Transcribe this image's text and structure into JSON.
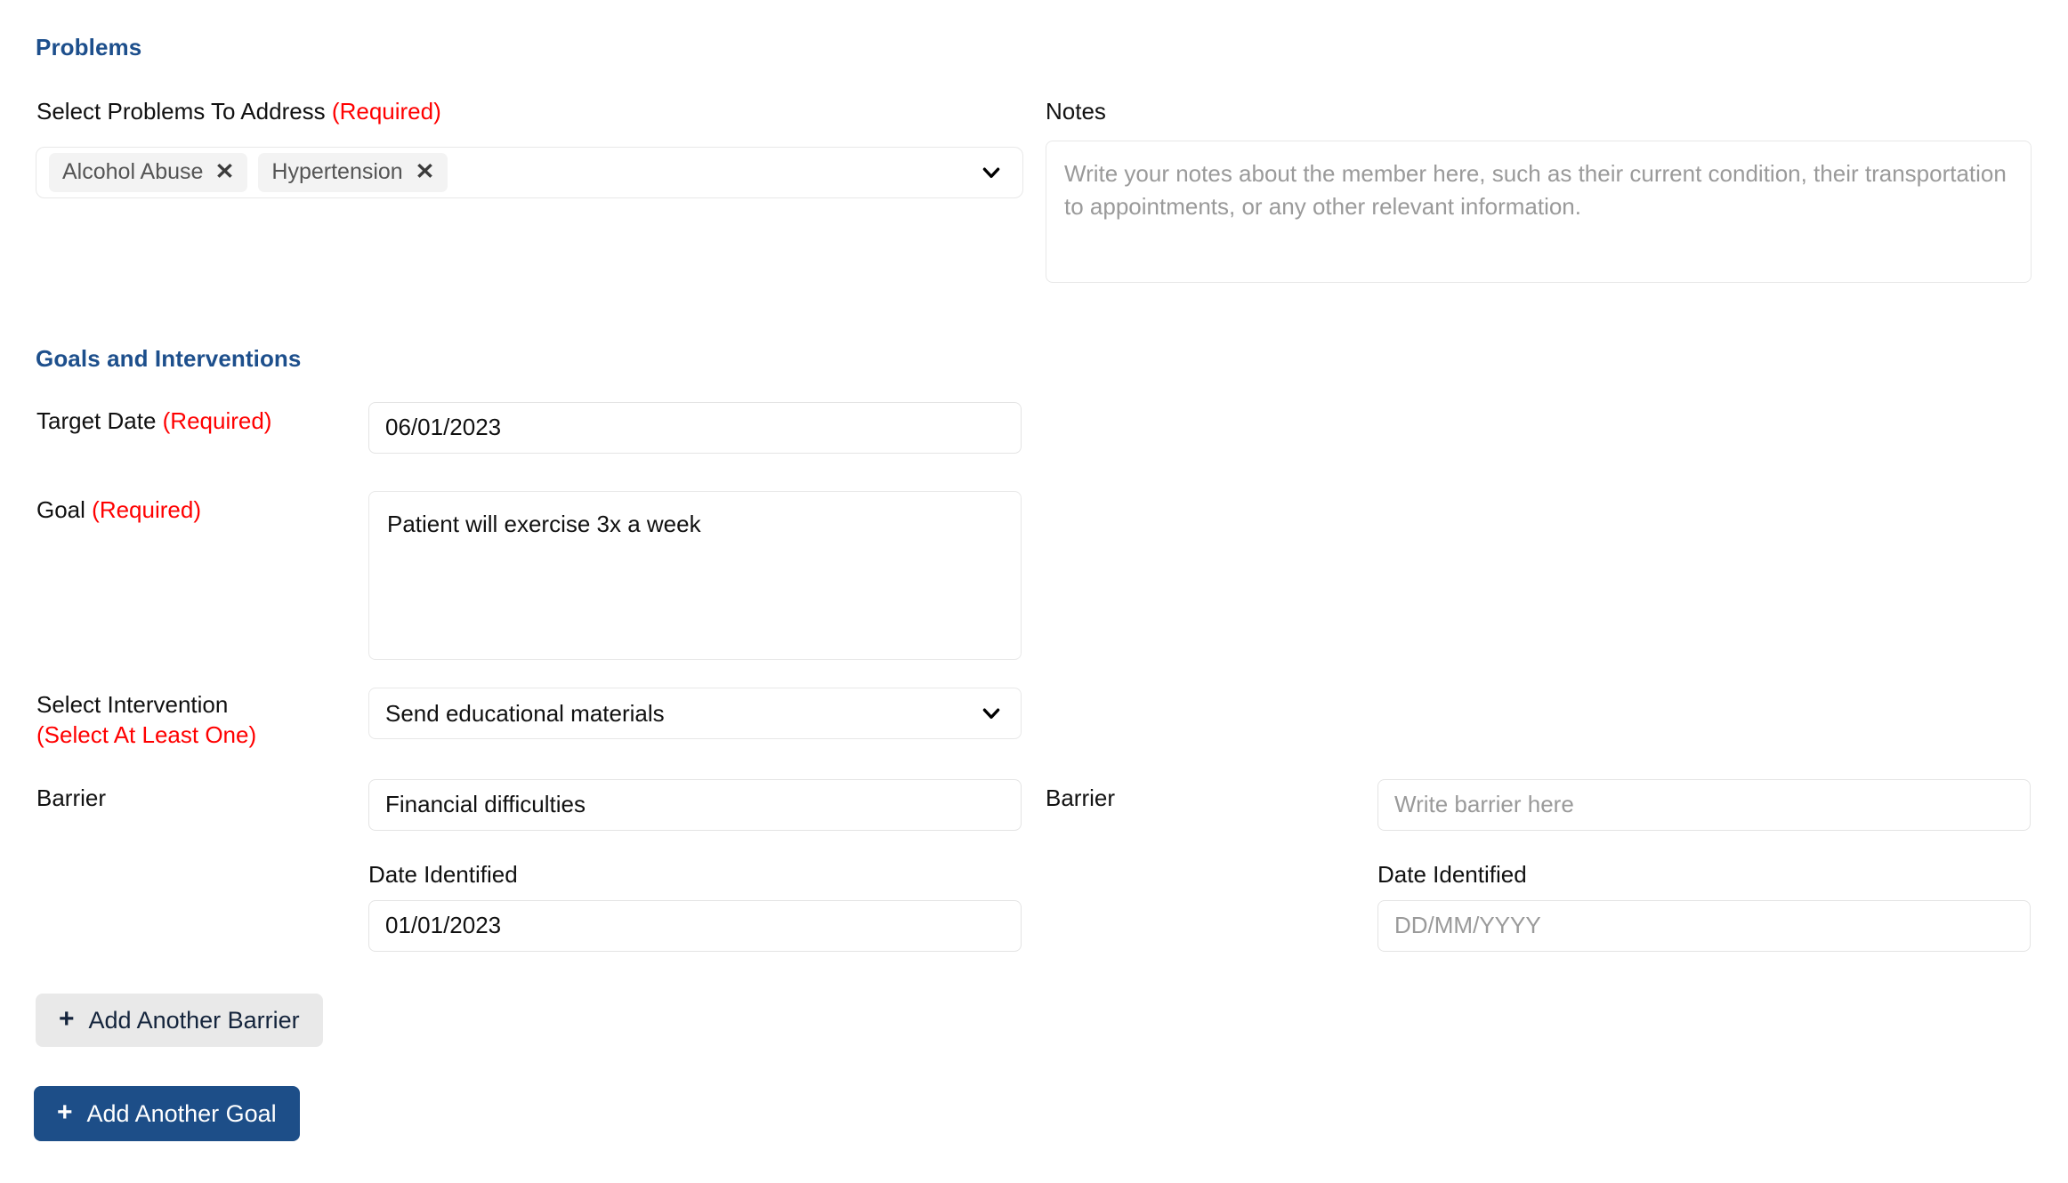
{
  "problems": {
    "heading": "Problems",
    "select_label": "Select Problems To Address",
    "select_required": "(Required)",
    "chips": [
      {
        "label": "Alcohol Abuse",
        "remove_icon": "✕"
      },
      {
        "label": "Hypertension",
        "remove_icon": "✕"
      }
    ]
  },
  "notes": {
    "label": "Notes",
    "value": "",
    "placeholder": "Write your notes about the member here, such as their current condition, their transportation to appointments, or any other relevant information."
  },
  "goals": {
    "heading": "Goals and Interventions",
    "target_date": {
      "label": "Target Date",
      "required": "(Required)",
      "value": "06/01/2023"
    },
    "goal": {
      "label": "Goal",
      "required": "(Required)",
      "value": "Patient will exercise 3x a week"
    },
    "intervention": {
      "label": "Select Intervention",
      "required": "(Select At Least One)",
      "value": "Send educational materials"
    },
    "barrier_left": {
      "label": "Barrier",
      "value": "Financial difficulties",
      "date_label": "Date Identified",
      "date_value": "01/01/2023"
    },
    "barrier_right": {
      "label": "Barrier",
      "value": "",
      "placeholder": "Write barrier here",
      "date_label": "Date Identified",
      "date_value": "",
      "date_placeholder": "DD/MM/YYYY"
    }
  },
  "buttons": {
    "add_barrier": "Add Another Barrier",
    "add_goal": "Add Another Goal",
    "plus_icon": "+"
  },
  "colors": {
    "accent_blue": "#1d4e88",
    "required_red": "#ff0000",
    "chip_bg": "#f3f3f3",
    "secondary_btn_bg": "#e9e9e9"
  }
}
